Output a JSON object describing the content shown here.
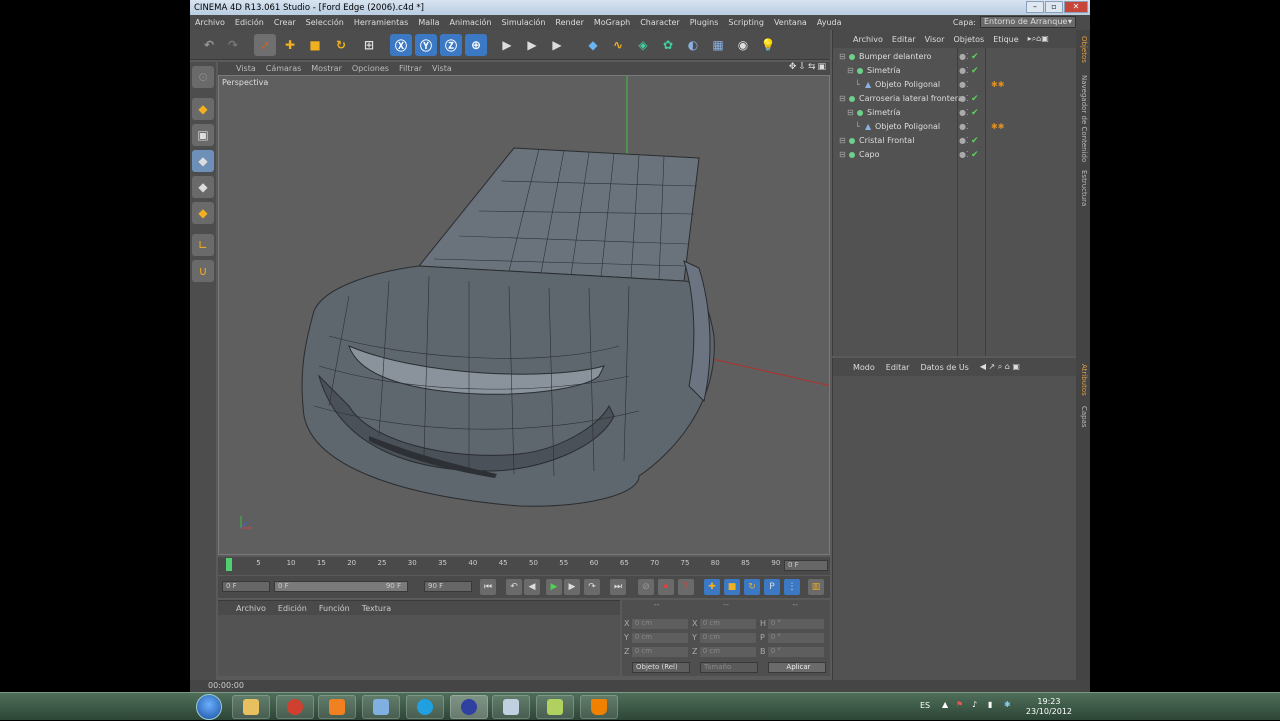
{
  "window": {
    "title": "CINEMA 4D R13.061 Studio - [Ford Edge (2006).c4d *]"
  },
  "menu": [
    "Archivo",
    "Edición",
    "Crear",
    "Selección",
    "Herramientas",
    "Malla",
    "Animación",
    "Simulación",
    "Render",
    "MoGraph",
    "Character",
    "Plugins",
    "Scripting",
    "Ventana",
    "Ayuda"
  ],
  "capa": {
    "label": "Capa:",
    "value": "Entorno de Arranque"
  },
  "viewport": {
    "menu": [
      "Vista",
      "Cámaras",
      "Mostrar",
      "Opciones",
      "Filtrar",
      "Vista"
    ],
    "label": "Perspectiva"
  },
  "timeline": {
    "ticks": [
      "0",
      "5",
      "10",
      "15",
      "20",
      "25",
      "30",
      "35",
      "40",
      "45",
      "50",
      "55",
      "60",
      "65",
      "70",
      "75",
      "80",
      "85",
      "90"
    ],
    "current": "0 F",
    "start_field": "0 F",
    "slider_label": "0 F",
    "slider_end": "90 F",
    "end_field": "90 F"
  },
  "materials": {
    "menu": [
      "Archivo",
      "Edición",
      "Función",
      "Textura"
    ]
  },
  "coords": {
    "headers": [
      "--",
      "--",
      "--"
    ],
    "rows": [
      {
        "a": "X",
        "av": "0 cm",
        "b": "X",
        "bv": "0 cm",
        "c": "H",
        "cv": "0 °"
      },
      {
        "a": "Y",
        "av": "0 cm",
        "b": "Y",
        "bv": "0 cm",
        "c": "P",
        "cv": "0 °"
      },
      {
        "a": "Z",
        "av": "0 cm",
        "b": "Z",
        "bv": "0 cm",
        "c": "B",
        "cv": "0 °"
      }
    ],
    "mode": "Objeto (Rel)",
    "size": "Tamaño",
    "apply": "Aplicar"
  },
  "status": "00:00:00",
  "objects": {
    "menu": [
      "Archivo",
      "Editar",
      "Visor",
      "Objetos",
      "Etique"
    ],
    "items": [
      {
        "name": "Bumper delantero",
        "level": 0
      },
      {
        "name": "Simetría",
        "level": 1
      },
      {
        "name": "Objeto Poligonal",
        "level": 2
      },
      {
        "name": "Carroseria lateral frontera",
        "level": 0
      },
      {
        "name": "Simetría",
        "level": 1
      },
      {
        "name": "Objeto Poligonal",
        "level": 2
      },
      {
        "name": "Cristal Frontal",
        "level": 0
      },
      {
        "name": "Capo",
        "level": 0
      }
    ]
  },
  "attributes": {
    "menu": [
      "Modo",
      "Editar",
      "Datos de Us"
    ]
  },
  "sidetabs": [
    "Objetos",
    "Navegador de Contenido",
    "Estructura",
    "Atributos",
    "Capas"
  ],
  "tray": {
    "lang": "ES",
    "time": "19:23",
    "date": "23/10/2012"
  }
}
